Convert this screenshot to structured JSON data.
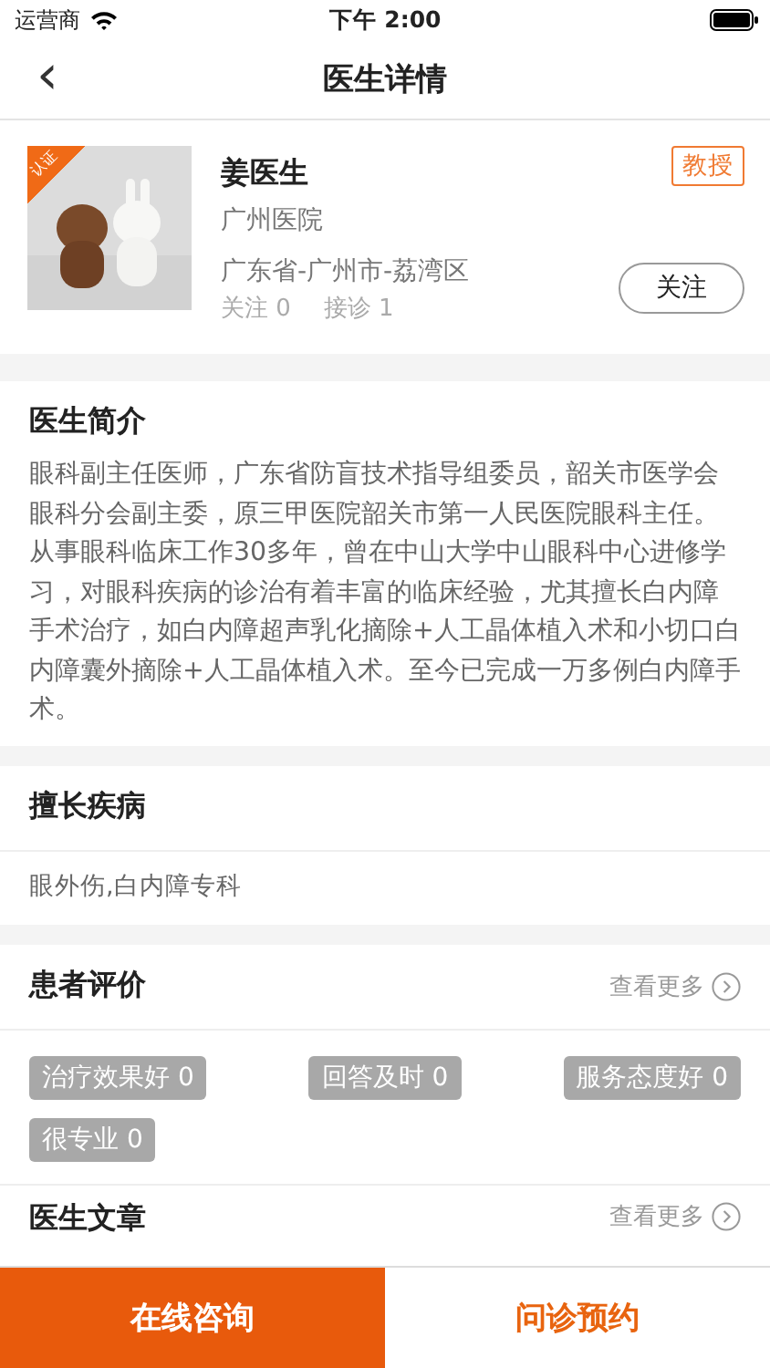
{
  "status_bar": {
    "carrier": "运营商",
    "time": "下午 2:00"
  },
  "nav": {
    "back": "‹",
    "title": "医生详情"
  },
  "doctor": {
    "badge": "认证",
    "name": "姜医生",
    "title_tag": "教授",
    "hospital": "广州医院",
    "region": "广东省-广州市-荔湾区",
    "stats": [
      "关注 0",
      "接诊 1"
    ],
    "follow_button": "关注"
  },
  "intro": {
    "heading": "医生简介",
    "text": "眼科副主任医师，广东省防盲技术指导组委员，韶关市医学会眼科分会副主委，原三甲医院韶关市第一人民医院眼科主任。从事眼科临床工作30多年，曾在中山大学中山眼科中心进修学习，对眼科疾病的诊治有着丰富的临床经验，尤其擅长白内障手术治疗，如白内障超声乳化摘除+人工晶体植入术和小切口白内障囊外摘除+人工晶体植入术。至今已完成一万多例白内障手术。"
  },
  "specialty": {
    "heading": "擅长疾病",
    "text": "眼外伤,白内障专科"
  },
  "reviews": {
    "heading": "患者评价",
    "more": "查看更多",
    "tags": [
      "治疗效果好 0",
      "回答及时 0",
      "服务态度好 0",
      "很专业 0"
    ]
  },
  "articles": {
    "heading": "医生文章",
    "more": "查看更多"
  },
  "bottom_bar": {
    "buttons": [
      {
        "label": "在线咨询",
        "kind": "primary"
      },
      {
        "label": "问诊预约",
        "kind": "secondary"
      }
    ]
  }
}
